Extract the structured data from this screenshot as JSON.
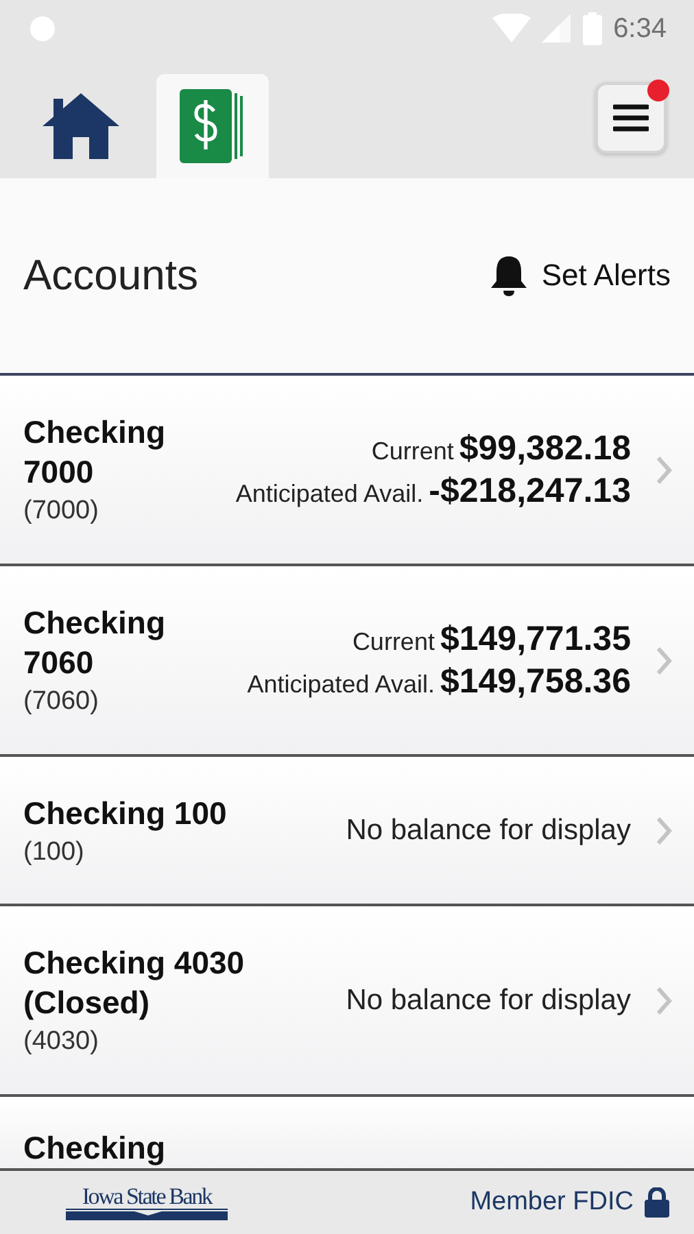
{
  "status_bar": {
    "time": "6:34"
  },
  "tabs": [
    {
      "kind": "home",
      "selected": false
    },
    {
      "kind": "accounts",
      "selected": true
    }
  ],
  "menu": {
    "has_notification": true
  },
  "header": {
    "title": "Accounts",
    "alerts_label": "Set Alerts"
  },
  "accounts": [
    {
      "kind": "balances",
      "name": "Checking 7000",
      "number": "(7000)",
      "lines": [
        {
          "label": "Current",
          "amount": "$99,382.18"
        },
        {
          "label": "Anticipated Avail.",
          "amount": "-$218,247.13"
        }
      ]
    },
    {
      "kind": "balances",
      "name": "Checking 7060",
      "number": "(7060)",
      "lines": [
        {
          "label": "Current",
          "amount": "$149,771.35"
        },
        {
          "label": "Anticipated Avail.",
          "amount": "$149,758.36"
        }
      ]
    },
    {
      "kind": "message",
      "name": "Checking 100",
      "number": "(100)",
      "message": "No balance for display"
    },
    {
      "kind": "message",
      "name": "Checking 4030 (Closed)",
      "number": "(4030)",
      "message": "No balance for display"
    },
    {
      "kind": "partial",
      "name": "Checking"
    }
  ],
  "footer": {
    "logo": "Iowa State Bank",
    "fdic": "Member FDIC"
  }
}
